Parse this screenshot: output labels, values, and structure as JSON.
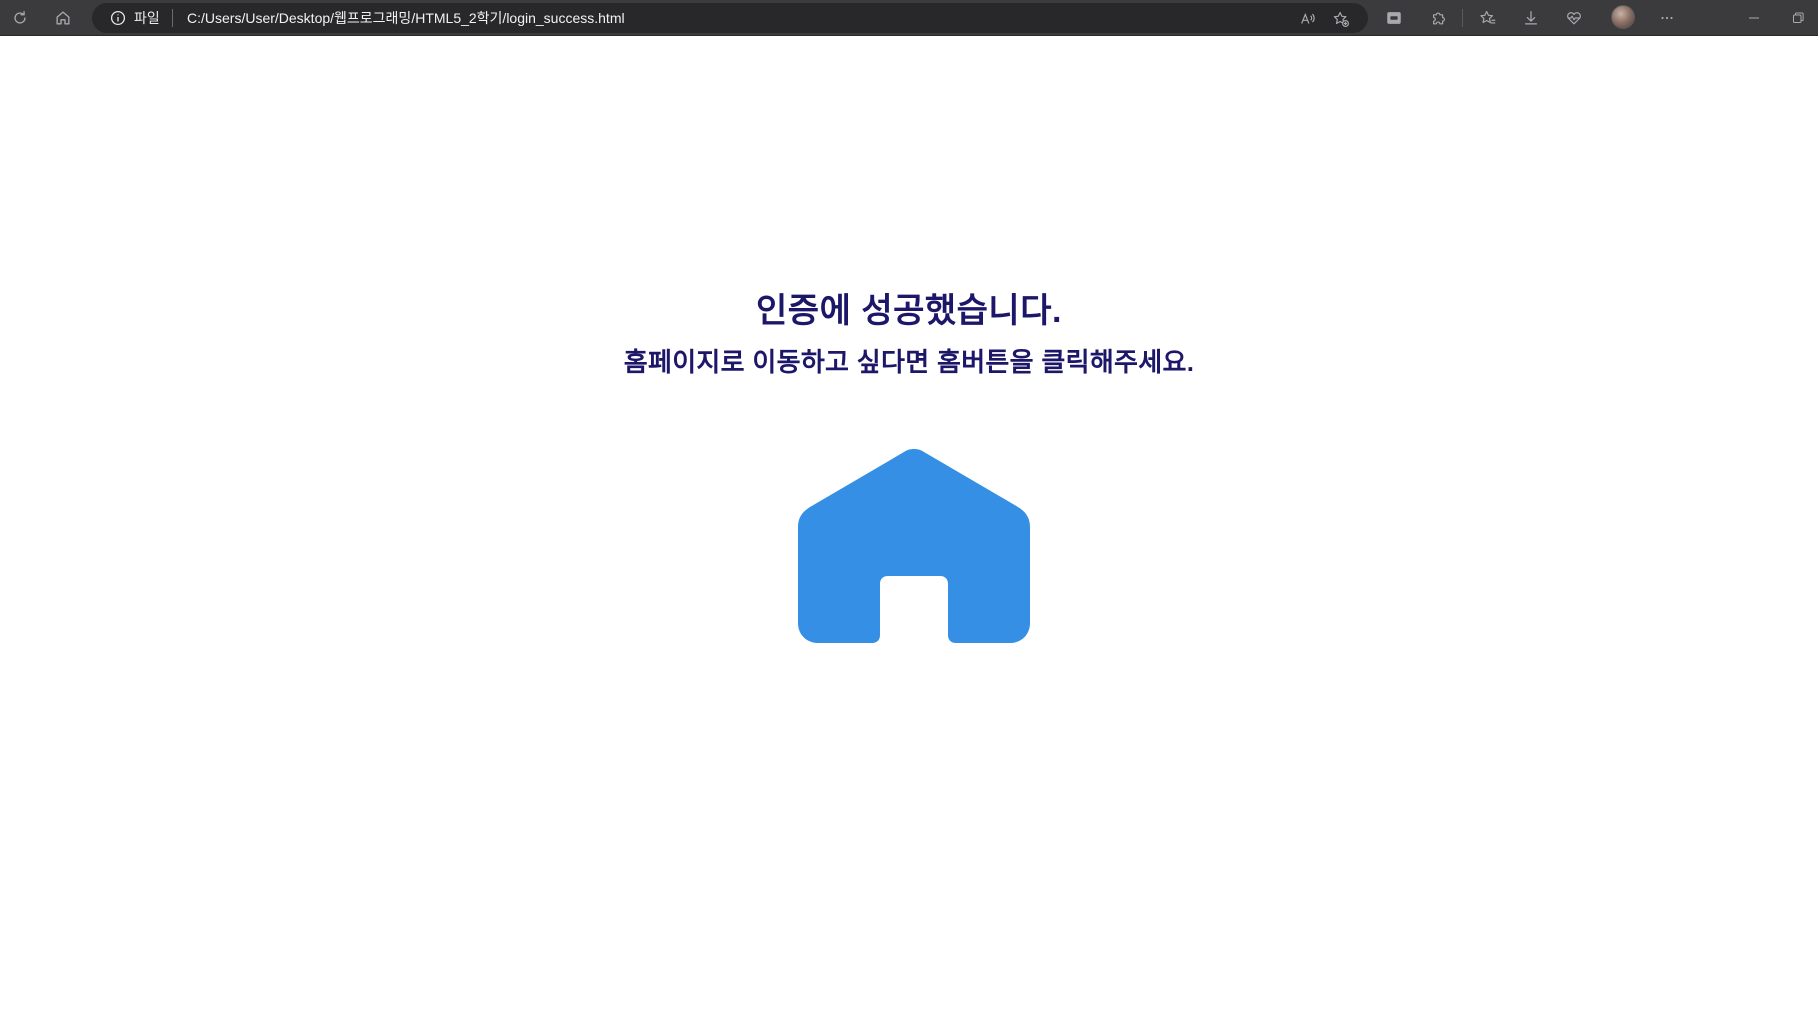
{
  "browser": {
    "address": {
      "scheme_label": "파일",
      "url": "C:/Users/User/Desktop/웹프로그래밍/HTML5_2학기/login_success.html"
    },
    "icons": {
      "refresh": "refresh-icon",
      "home": "home-icon",
      "info": "info-icon",
      "read_aloud": "read-aloud-icon",
      "add_favorite": "add-favorite-icon",
      "extension_ext": "extension-ext-icon",
      "extensions": "puzzle-icon",
      "favorites": "favorites-icon",
      "downloads": "download-icon",
      "browser_essentials": "heart-pulse-icon",
      "profile": "avatar",
      "more": "more-icon",
      "minimize": "minimize-icon",
      "restore": "restore-icon"
    }
  },
  "page": {
    "heading": "인증에 성공했습니다.",
    "message": "홈페이지로 이동하고 싶다면 홈버튼을 클릭해주세요.",
    "home_button_icon": "home-icon"
  },
  "colors": {
    "text": "#1d1769",
    "home_icon": "#348fe5",
    "toolbar_bg": "#3b3b3e",
    "address_bg": "#28282b"
  }
}
